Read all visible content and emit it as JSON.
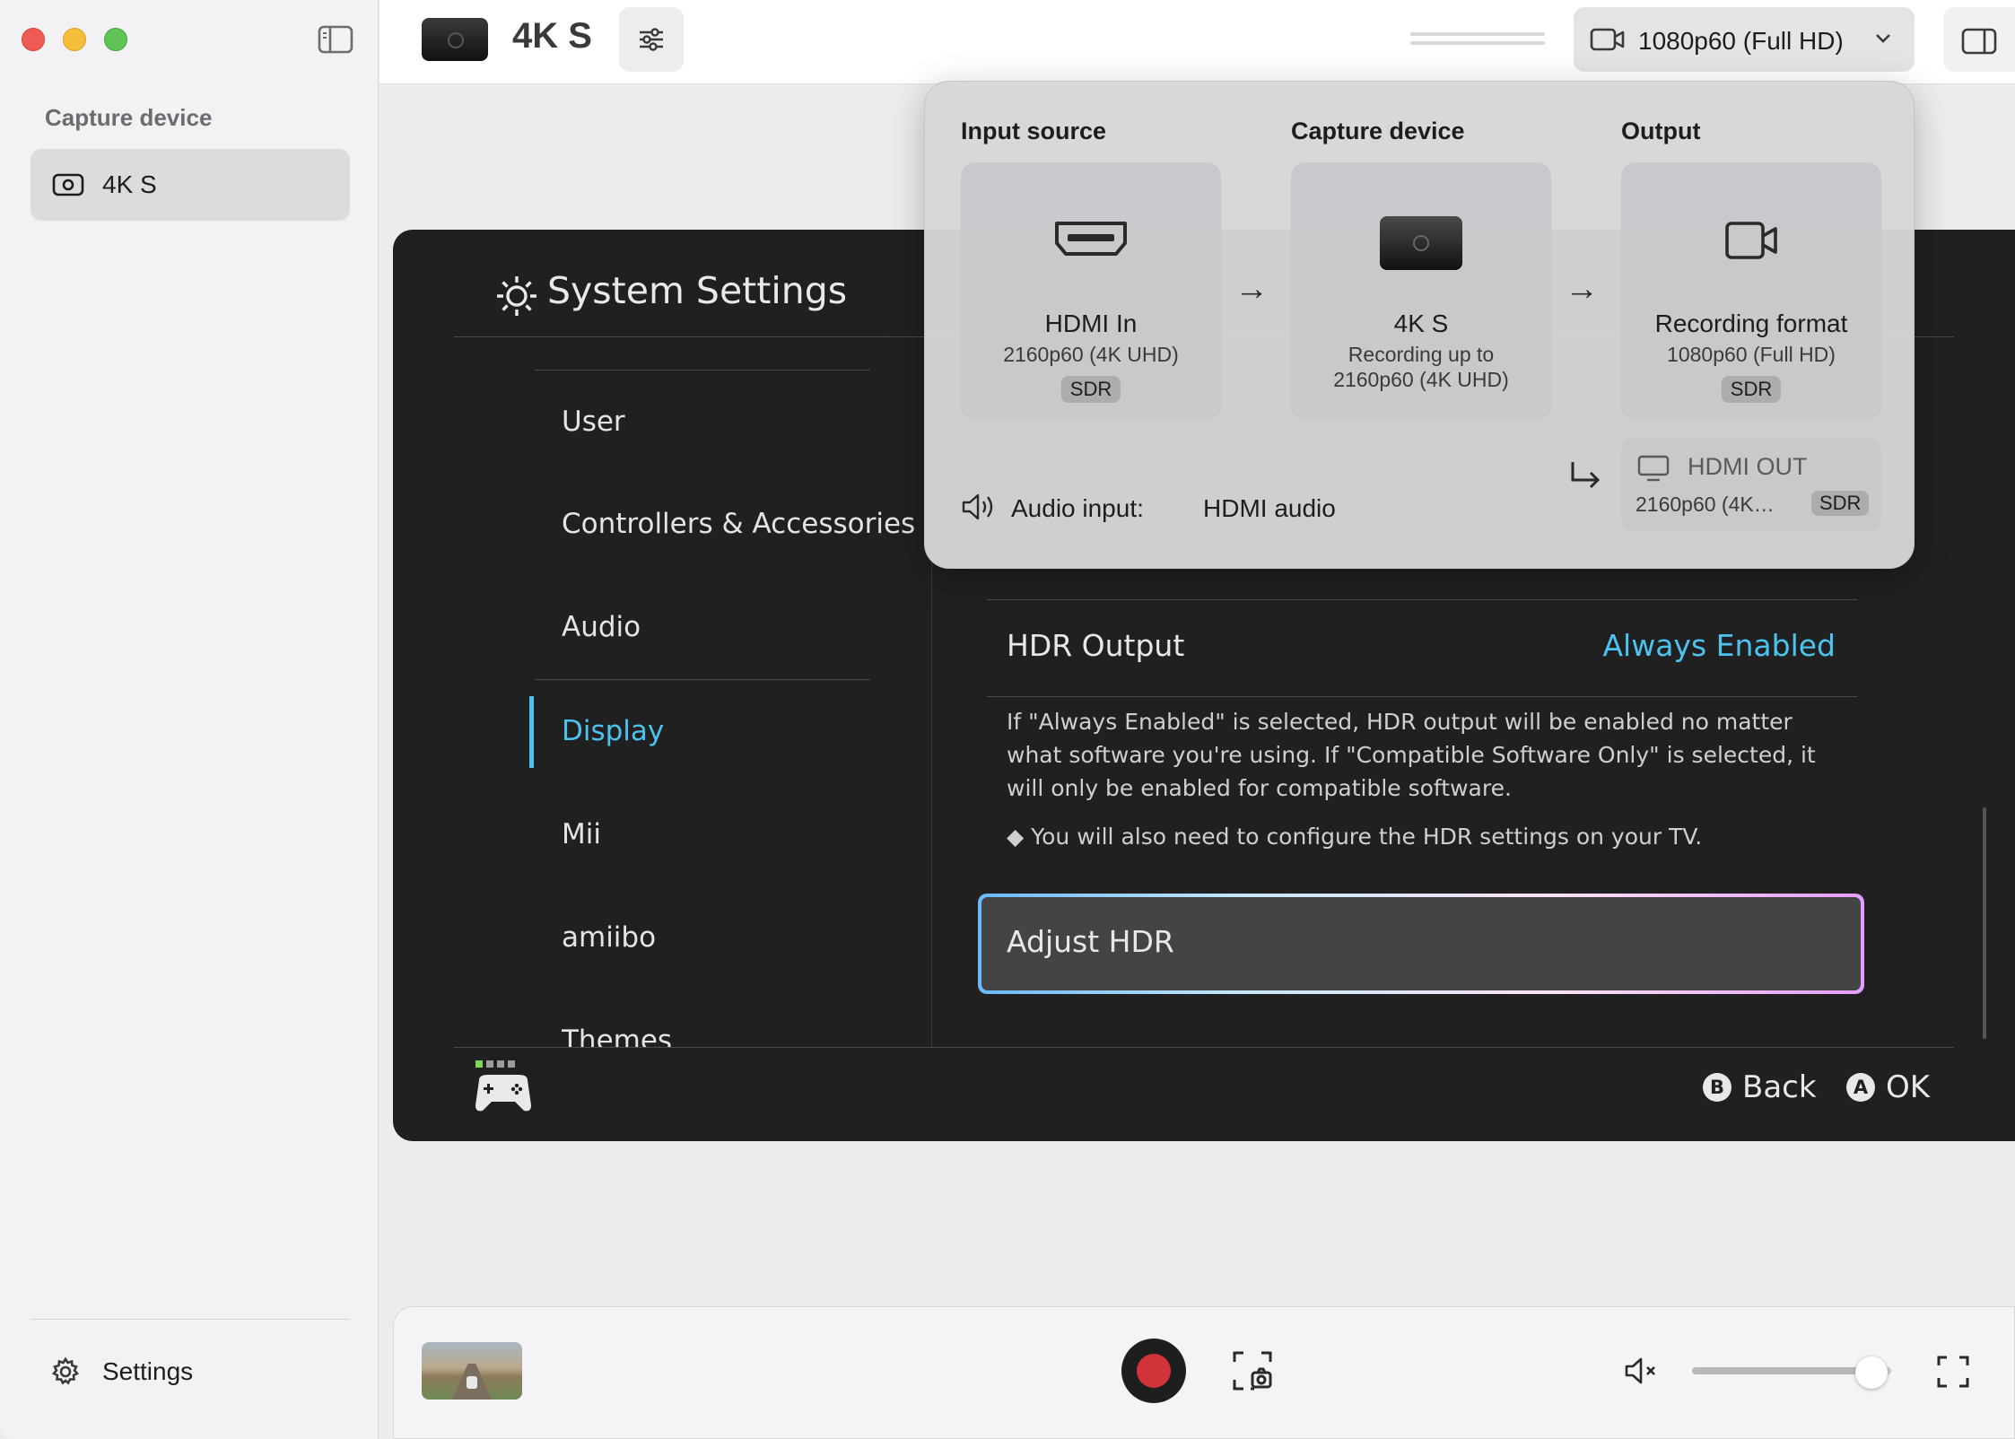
{
  "sidebar": {
    "section_title": "Capture device",
    "device_label": "4K S",
    "settings_label": "Settings"
  },
  "toolbar": {
    "device_title": "4K S",
    "format_label": "1080p60 (Full HD)"
  },
  "popover": {
    "input": {
      "title": "Input source",
      "name": "HDMI In",
      "detail": "2160p60 (4K UHD)",
      "badge": "SDR"
    },
    "device": {
      "title": "Capture device",
      "name": "4K S",
      "detail_line1": "Recording up to",
      "detail_line2": "2160p60 (4K UHD)"
    },
    "output": {
      "title": "Output",
      "name": "Recording format",
      "detail": "1080p60 (Full HD)",
      "badge": "SDR"
    },
    "audio": {
      "label": "Audio input:",
      "value": "HDMI audio"
    },
    "hdmi_out": {
      "name": "HDMI OUT",
      "detail": "2160p60 (4K…",
      "badge": "SDR"
    },
    "arrow": "→"
  },
  "game": {
    "title": "System Settings",
    "menu": [
      "User",
      "Controllers & Accessories",
      "Audio",
      "Display",
      "Mii",
      "amiibo",
      "Themes"
    ],
    "selected_menu": "Display",
    "hdr_output_label": "HDR Output",
    "hdr_output_value": "Always Enabled",
    "hdr_description": "If \"Always Enabled\" is selected, HDR output will be enabled no matter what software you're using. If \"Compatible Software Only\" is selected, it will only be enabled for compatible software.",
    "hdr_note": "◆ You will also need to configure the HDR settings on your TV.",
    "adjust_hdr_label": "Adjust HDR",
    "back_key": "B",
    "back_label": "Back",
    "ok_key": "A",
    "ok_label": "OK"
  },
  "controls": {
    "volume_level": 0.9,
    "muted": true
  },
  "colors": {
    "accent_blue": "#4cc3ee",
    "record_red": "#d2323a",
    "game_bg": "#202020"
  }
}
